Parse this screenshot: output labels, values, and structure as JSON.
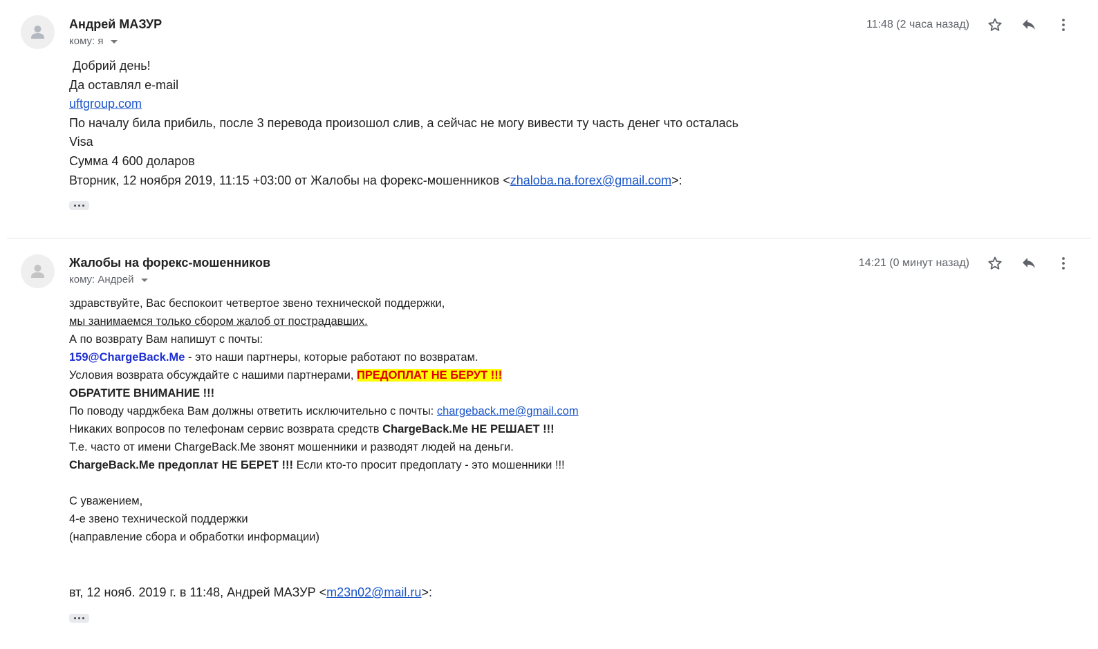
{
  "messages": [
    {
      "sender": "Андрей МАЗУР",
      "recipient": "кому: я",
      "time": "11:48 (2 часа назад)",
      "lines": [
        " Добрий день!",
        "Да оставлял e-mail",
        "uftgroup.com",
        "По началу била прибиль, после 3 перевода произошол слив, а сейчас не могу вивести ту часть денег что осталась",
        "Visa",
        "Сумма 4 600 доларов"
      ],
      "quote_prefix": "Вторник, 12 ноября 2019, 11:15 +03:00 от Жалобы на форекс-мошенников <",
      "quote_email": "zhaloba.na.forex@gmail.com",
      "quote_suffix": ">:"
    },
    {
      "sender": "Жалобы на форекс-мошенников",
      "recipient": "кому: Андрей",
      "time": "14:21 (0 минут назад)",
      "line1": "здравствуйте, Вас беспокоит четвертое звено технической поддержки,",
      "line2": "мы занимаемся только сбором жалоб от пострадавших.",
      "line3": "А по возврату Вам напишут с почты:",
      "line4_email": "159@ChargeBack.Me",
      "line4_rest": " - это наши партнеры, которые работают по возвратам.",
      "line5_text": "Условия возврата обсуждайте с нашими партнерами, ",
      "line5_highlight": "ПРЕДОПЛАТ НЕ БЕРУТ !!!",
      "line6": "ОБРАТИТЕ ВНИМАНИЕ !!!",
      "line7_text": "По поводу чарджбека Вам должны ответить исключительно с почты: ",
      "line7_email": "chargeback.me@gmail.com",
      "line8_text": "Никаких вопросов по телефонам сервис возврата средств ",
      "line8_bold": "ChargeBack.Me НЕ РЕШАЕТ !!!",
      "line9": "Т.е. часто от имени ChargeBack.Me звонят мошенники и разводят людей на деньги.",
      "line10_bold": "ChargeBack.Me предоплат НЕ БЕРЕТ !!!",
      "line10_rest": " Если кто-то просит предоплату - это мошенники !!!",
      "sign1": "С уважением,",
      "sign2": "4-е звено технической поддержки",
      "sign3": "(направление сбора и обработки информации)",
      "quote_prefix": "вт, 12 нояб. 2019 г. в 11:48, Андрей МАЗУР <",
      "quote_email": "m23n02@mail.ru",
      "quote_suffix": ">:"
    }
  ]
}
